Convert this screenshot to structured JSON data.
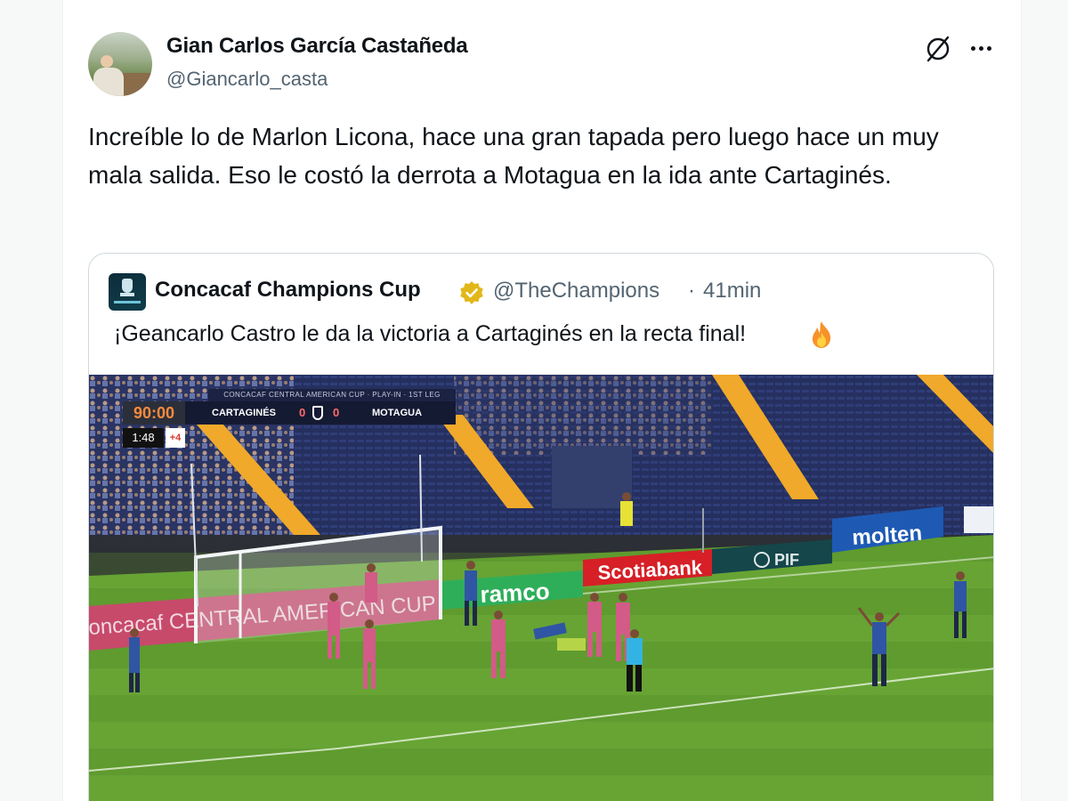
{
  "tweet": {
    "author_name": "Gian Carlos García Castañeda",
    "author_handle": "@Giancarlo_casta",
    "text": "Increíble lo de Marlon Licona, hace una gran tapada pero luego hace un muy mala salida. Eso le costó la derrota a Motagua en la ida ante Cartaginés.",
    "icons": [
      "noshow-icon",
      "more-icon"
    ]
  },
  "quote": {
    "author_name": "Concacaf Champions Cup",
    "author_handle": "@TheChampions",
    "separator": "·",
    "time": "41min",
    "text": "¡Geancarlo Castro le da la victoria a Cartaginés en la recta final!",
    "emoji_icon": "fire-icon",
    "verified_icon": "verified-badge-icon"
  },
  "media": {
    "scorebug": {
      "competition": "CONCACAF CENTRAL AMERICAN CUP · PLAY-IN · 1ST LEG",
      "clock": "90:00",
      "home_team": "CARTAGINÉS",
      "home_score": "0",
      "away_team": "MOTAGUA",
      "away_score": "0",
      "sub_clock": "1:48",
      "added_time": "+4"
    },
    "boards": {
      "concacaf_board": "oncacaf CENTRAL AMERICAN CUP",
      "ramco": "ramco",
      "scotiabank": "Scotiabank",
      "pif": "PIF",
      "molten": "molten"
    }
  },
  "colors": {
    "text_primary": "#0f1419",
    "text_secondary": "#536471",
    "border": "#cfd9de",
    "verified_gold": "#e2b719",
    "pitch": "#5e9a2e"
  }
}
